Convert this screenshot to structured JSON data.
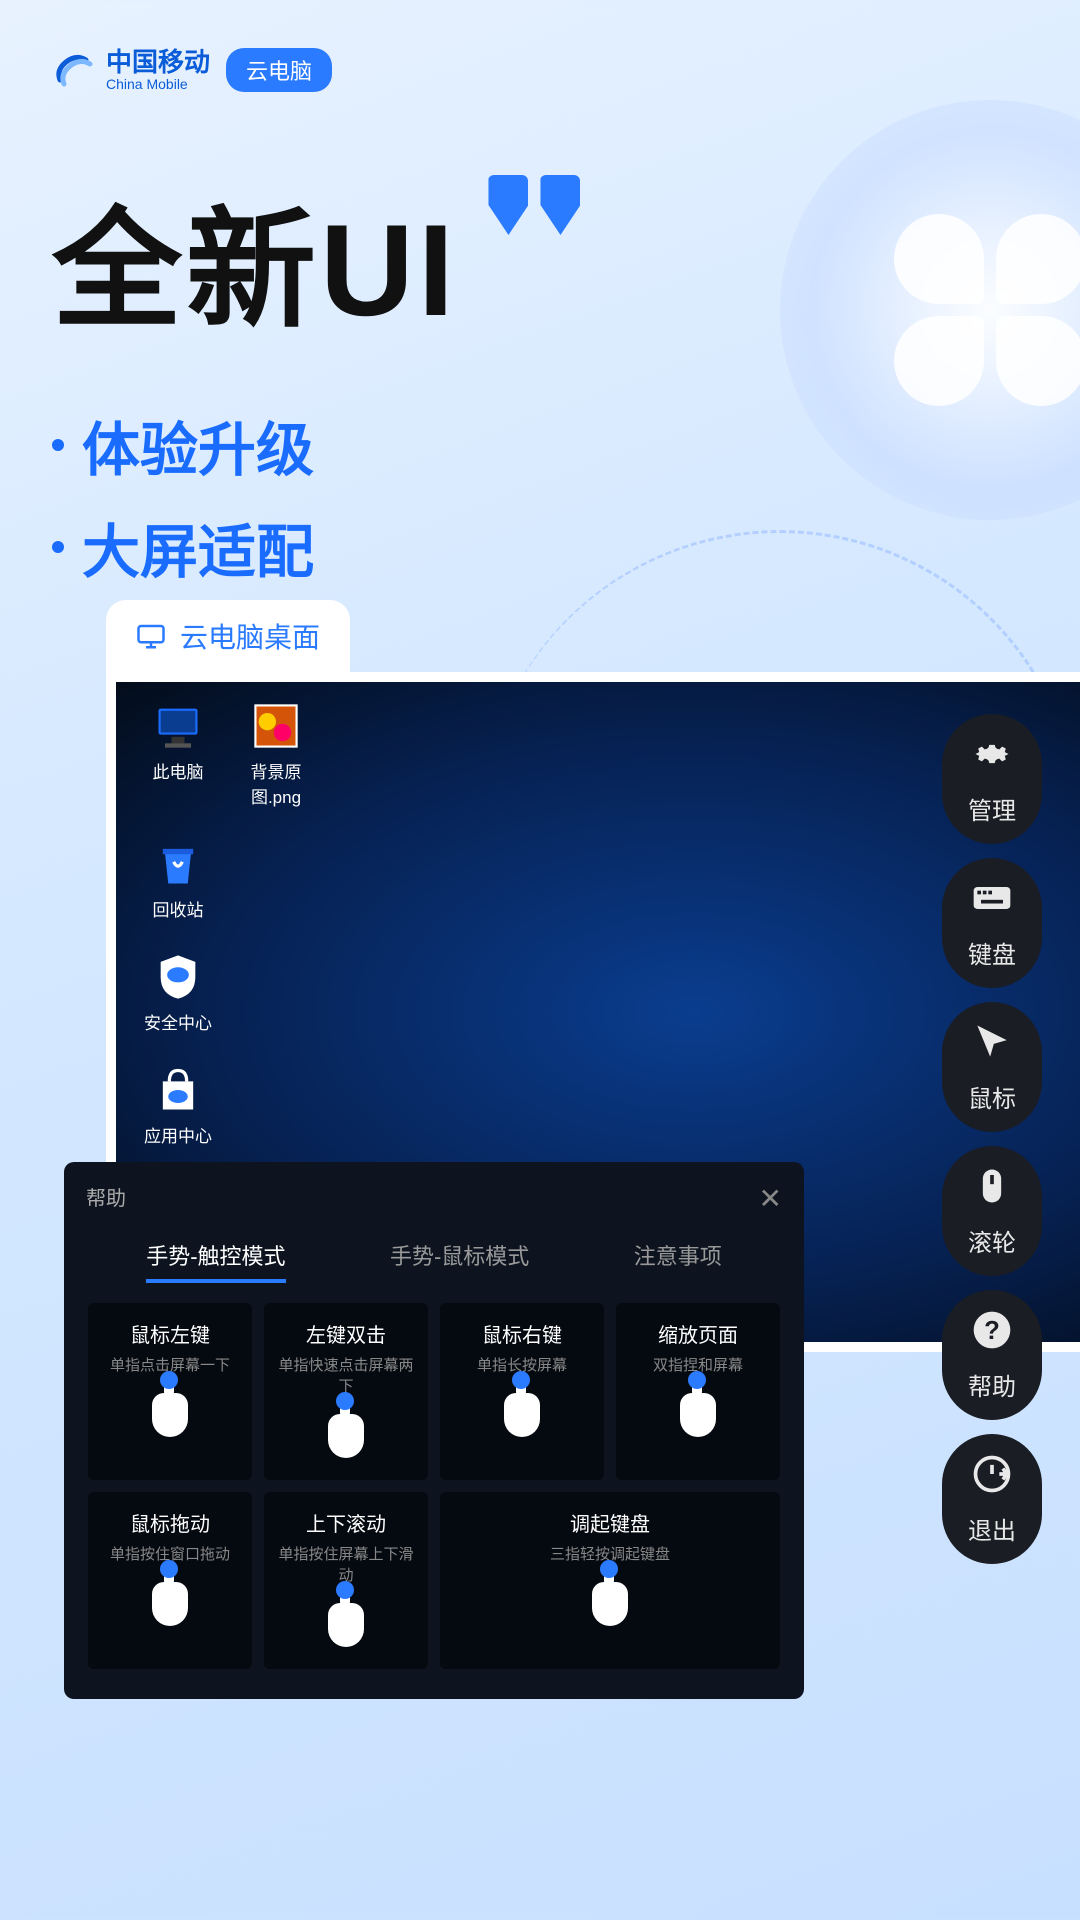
{
  "brand": {
    "cn": "中国移动",
    "en": "China Mobile",
    "badge": "云电脑"
  },
  "hero": {
    "title": "全新UI",
    "bullets": [
      "体验升级",
      "大屏适配"
    ]
  },
  "tab": {
    "label": "云电脑桌面"
  },
  "desktop_icons": [
    {
      "label": "此电脑",
      "icon": "pc"
    },
    {
      "label": "背景原图.png",
      "icon": "image"
    },
    {
      "label": "回收站",
      "icon": "bin"
    },
    {
      "label": "安全中心",
      "icon": "shield"
    },
    {
      "label": "应用中心",
      "icon": "store"
    }
  ],
  "rail": [
    {
      "label": "管理",
      "icon": "gear"
    },
    {
      "label": "键盘",
      "icon": "keyboard"
    },
    {
      "label": "鼠标",
      "icon": "cursor"
    },
    {
      "label": "滚轮",
      "icon": "mouse"
    },
    {
      "label": "帮助",
      "icon": "help"
    },
    {
      "label": "退出",
      "icon": "exit"
    }
  ],
  "help": {
    "title": "帮助",
    "tabs": [
      "手势-触控模式",
      "手势-鼠标模式",
      "注意事项"
    ],
    "active_tab": 0,
    "gestures": [
      {
        "title": "鼠标左键",
        "sub": "单指点击屏幕一下"
      },
      {
        "title": "左键双击",
        "sub": "单指快速点击屏幕两下"
      },
      {
        "title": "鼠标右键",
        "sub": "单指长按屏幕"
      },
      {
        "title": "缩放页面",
        "sub": "双指捏和屏幕"
      },
      {
        "title": "鼠标拖动",
        "sub": "单指按住窗口拖动"
      },
      {
        "title": "上下滚动",
        "sub": "单指按住屏幕上下滑动"
      },
      {
        "title": "调起键盘",
        "sub": "三指轻按调起键盘",
        "wide": true
      }
    ]
  }
}
